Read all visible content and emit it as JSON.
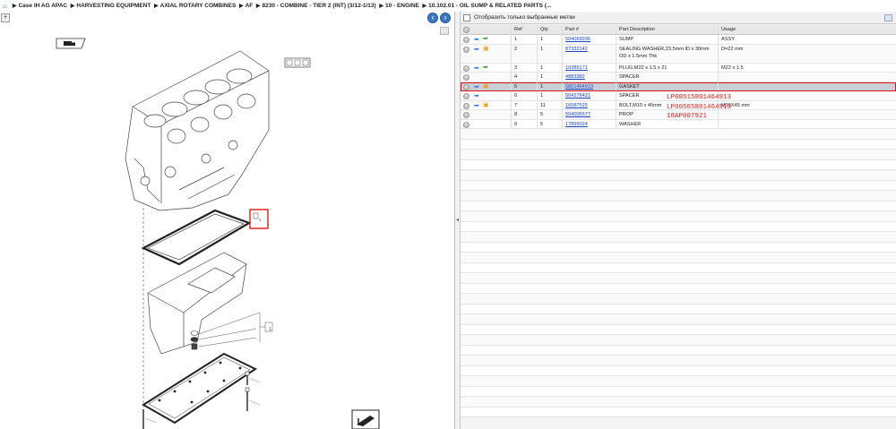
{
  "breadcrumb": {
    "home_icon": "home-icon",
    "items": [
      "Case IH AG APAC",
      "HARVESTING EQUIPMENT",
      "AXIAL ROTARY COMBINES",
      "AF",
      "8230 - COMBINE - TIER 2 (INT) (3/12-1/13)",
      "10 - ENGINE",
      "10.102.01 - OIL SUMP & RELATED PARTS (..."
    ]
  },
  "left_toolbar": {
    "zoom_label": "+",
    "prev_label": "‹",
    "next_label": "›"
  },
  "filter": {
    "label": "Отобразить только выбранные метки"
  },
  "grid": {
    "headers": [
      "",
      "Ref",
      "Qty",
      "Part #",
      "Part Description",
      "Usage"
    ],
    "rows": [
      {
        "icon3": "recycle-icon",
        "ref": "1",
        "qty": "1",
        "part": "504069936",
        "desc": "SUMP",
        "usage": "ASSY"
      },
      {
        "icon3": "box-icon",
        "ref": "2",
        "qty": "1",
        "part": "87332142",
        "desc": "SEALING WASHER,23.5mm ID x 30mm OD x 1.5mm Thk",
        "usage": "D=22 mm"
      },
      {
        "icon3": "recycle-icon",
        "ref": "3",
        "qty": "1",
        "part": "10385171",
        "desc": "PLUG,M22 x 1.5 x 21",
        "usage": "M22 x 1.5"
      },
      {
        "icon3": "",
        "ref": "4",
        "qty": "1",
        "part": "4883382",
        "desc": "SPACER",
        "usage": ""
      },
      {
        "icon3": "box-icon",
        "ref": "5",
        "qty": "1",
        "part": "5801464913",
        "desc": "GASKET",
        "usage": ""
      },
      {
        "icon3": "",
        "ref": "6",
        "qty": "1",
        "part": "504276421",
        "desc": "SPACER",
        "usage": ""
      },
      {
        "icon3": "box-icon",
        "ref": "7",
        "qty": "11",
        "part": "16587525",
        "desc": "BOLT,M10 x 45mm",
        "usage": "M10X45 mm"
      },
      {
        "icon3": "",
        "ref": "8",
        "qty": "5",
        "part": "504005577",
        "desc": "PROP",
        "usage": ""
      },
      {
        "icon3": "",
        "ref": "9",
        "qty": "5",
        "part": "17895024",
        "desc": "WASHER",
        "usage": ""
      }
    ],
    "selected_ref": "5"
  },
  "overlays": [
    "LP00515801464913",
    "LP00505801464913",
    "18AP007921"
  ],
  "drawing": {
    "callout_label": "1",
    "ref_tag": "5",
    "colors": {
      "highlight": "#e01818",
      "link": "#1a44c8",
      "selected_row": "#c8cfd6"
    }
  }
}
